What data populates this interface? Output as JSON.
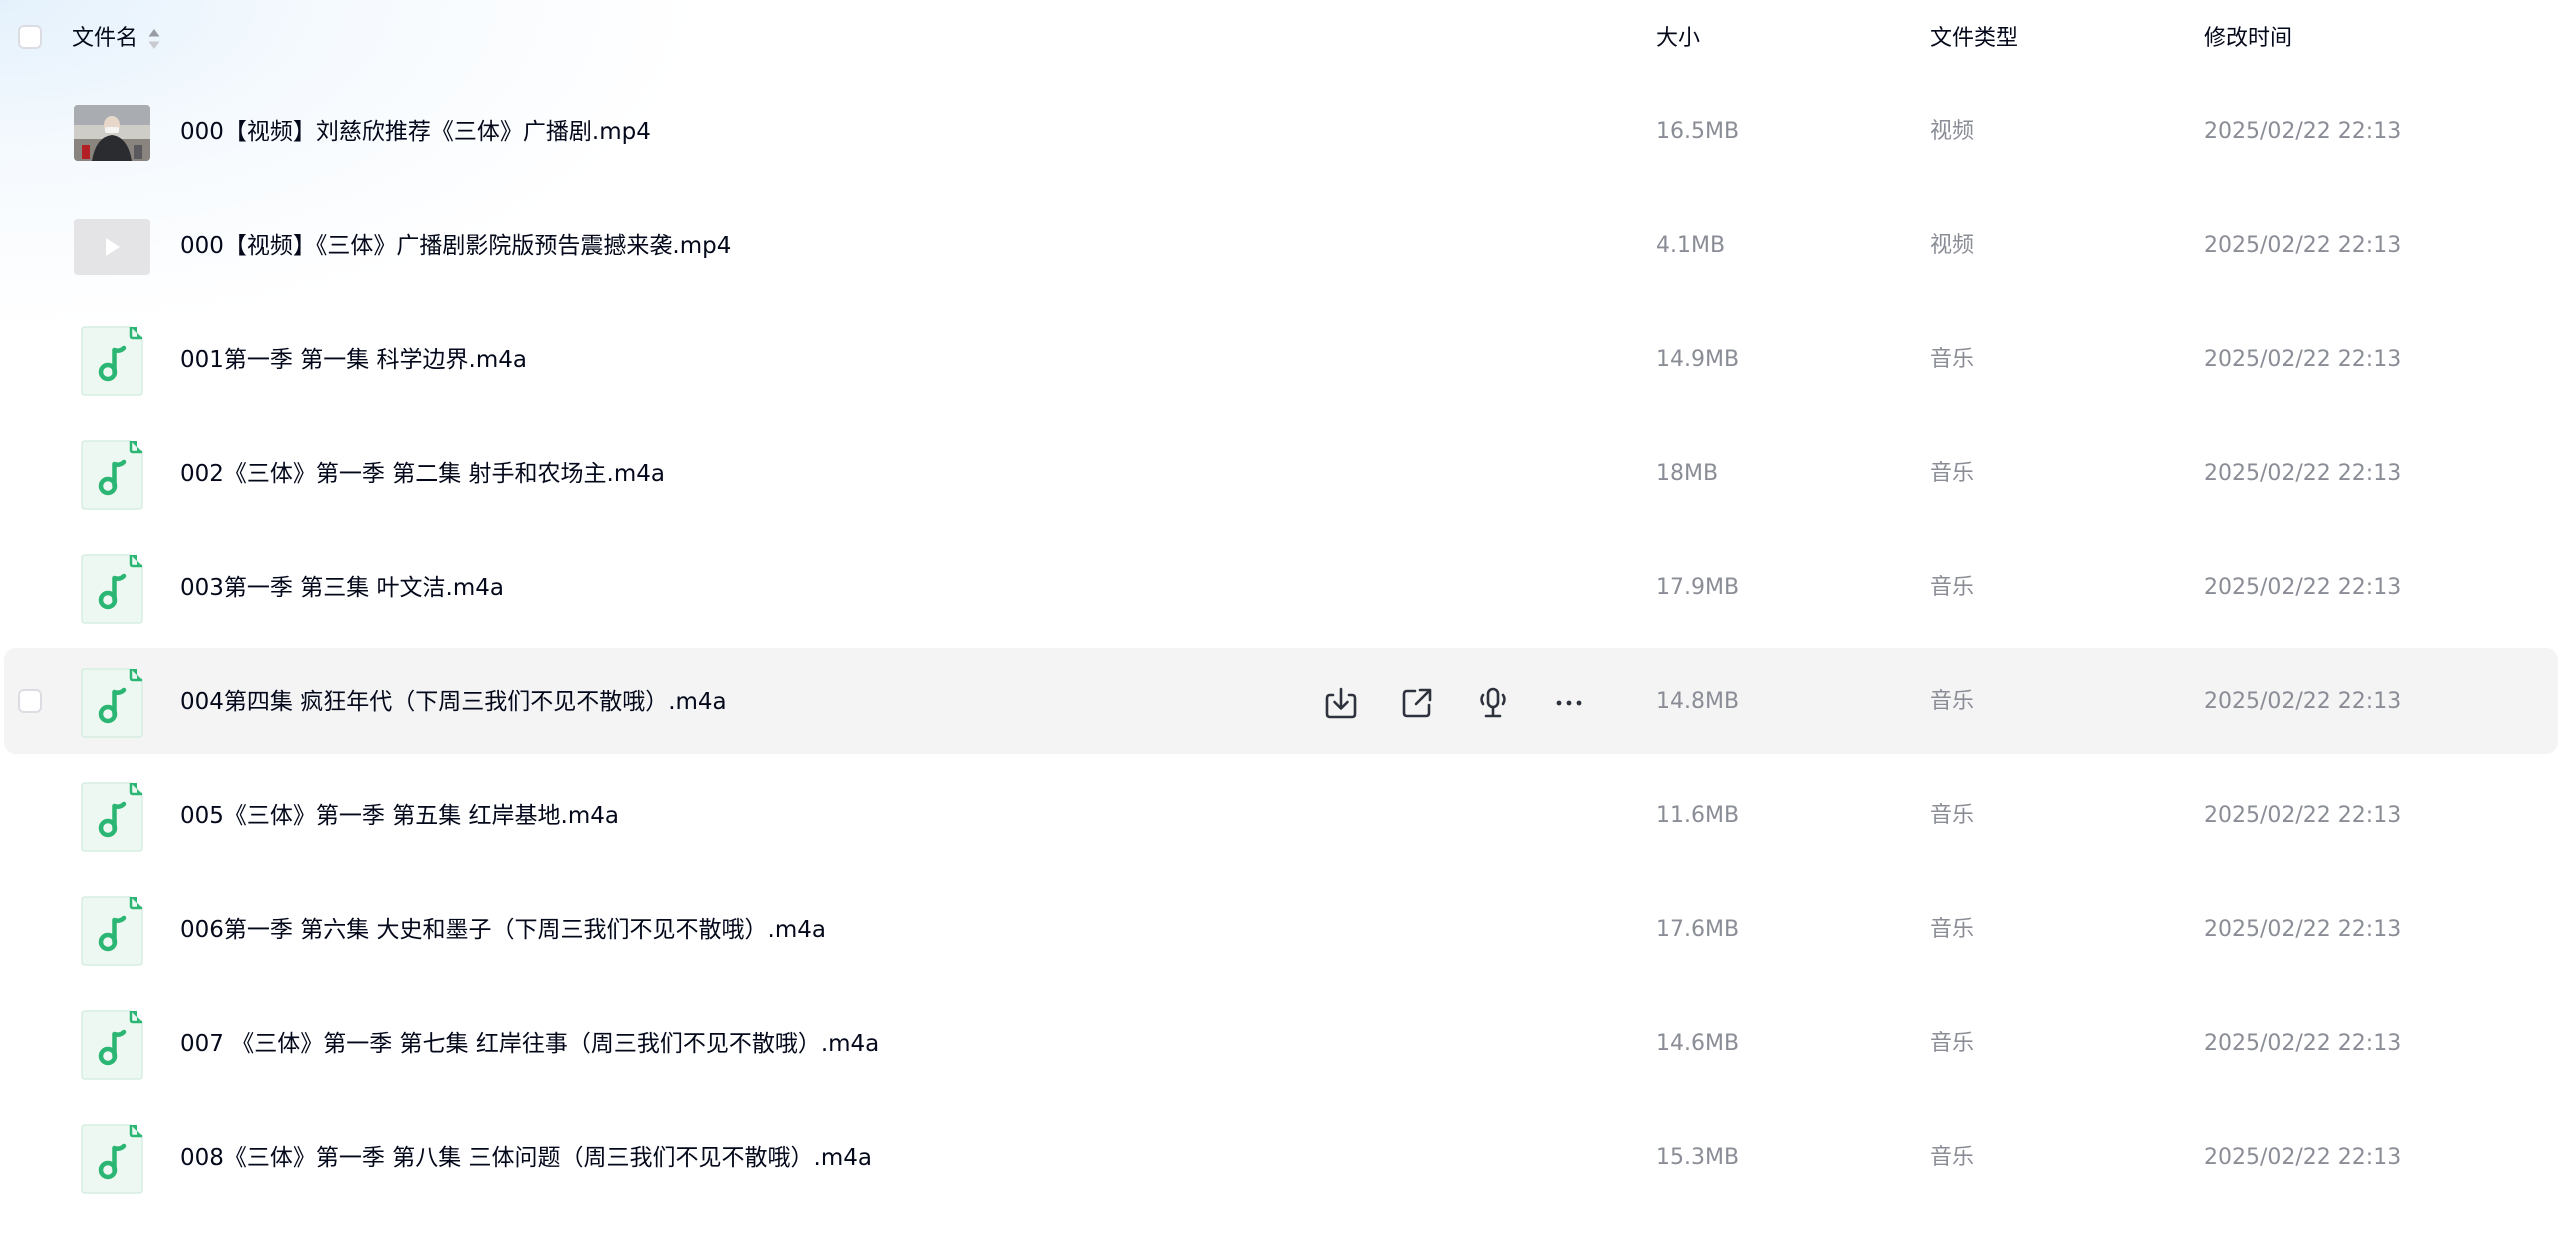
{
  "header": {
    "name_label": "文件名",
    "size_label": "大小",
    "type_label": "文件类型",
    "time_label": "修改时间"
  },
  "hovered_row_actions": [
    "download-icon",
    "share-icon",
    "podcast-icon",
    "more-icon"
  ],
  "colors": {
    "accent_green": "#2bb673",
    "text_primary": "#03081a",
    "text_secondary": "#8a8d96",
    "hover_bg": "#f4f4f5"
  },
  "files": [
    {
      "name": "000【视频】刘慈欣推荐《三体》广播剧.mp4",
      "size": "16.5MB",
      "type": "视频",
      "modified": "2025/02/22 22:13",
      "icon": "video-thumbnail"
    },
    {
      "name": "000【视频】《三体》广播剧影院版预告震撼来袭.mp4",
      "size": "4.1MB",
      "type": "视频",
      "modified": "2025/02/22 22:13",
      "icon": "video-placeholder-icon"
    },
    {
      "name": "001第一季 第一集 科学边界.m4a",
      "size": "14.9MB",
      "type": "音乐",
      "modified": "2025/02/22 22:13",
      "icon": "music-file-icon"
    },
    {
      "name": "002《三体》第一季 第二集 射手和农场主.m4a",
      "size": "18MB",
      "type": "音乐",
      "modified": "2025/02/22 22:13",
      "icon": "music-file-icon"
    },
    {
      "name": "003第一季 第三集 叶文洁.m4a",
      "size": "17.9MB",
      "type": "音乐",
      "modified": "2025/02/22 22:13",
      "icon": "music-file-icon"
    },
    {
      "name": "004第四集 疯狂年代（下周三我们不见不散哦）.m4a",
      "size": "14.8MB",
      "type": "音乐",
      "modified": "2025/02/22 22:13",
      "icon": "music-file-icon",
      "hovered": true
    },
    {
      "name": "005《三体》第一季 第五集 红岸基地.m4a",
      "size": "11.6MB",
      "type": "音乐",
      "modified": "2025/02/22 22:13",
      "icon": "music-file-icon"
    },
    {
      "name": "006第一季 第六集 大史和墨子（下周三我们不见不散哦）.m4a",
      "size": "17.6MB",
      "type": "音乐",
      "modified": "2025/02/22 22:13",
      "icon": "music-file-icon"
    },
    {
      "name": "007 《三体》第一季 第七集 红岸往事（周三我们不见不散哦）.m4a",
      "size": "14.6MB",
      "type": "音乐",
      "modified": "2025/02/22 22:13",
      "icon": "music-file-icon"
    },
    {
      "name": "008《三体》第一季 第八集 三体问题（周三我们不见不散哦）.m4a",
      "size": "15.3MB",
      "type": "音乐",
      "modified": "2025/02/22 22:13",
      "icon": "music-file-icon"
    }
  ]
}
